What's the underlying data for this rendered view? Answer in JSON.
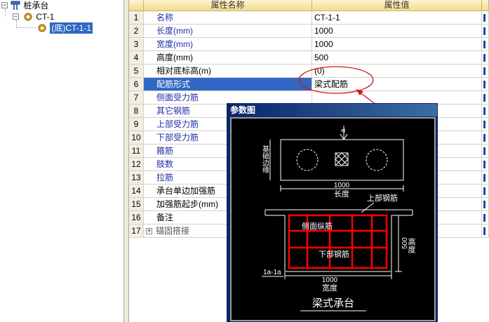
{
  "tree": {
    "root_label": "桩承台",
    "child_label": "CT-1",
    "leaf_label": "(底)CT-1-1"
  },
  "grid": {
    "header_name": "属性名称",
    "header_value": "属性值",
    "rows": [
      {
        "num": "1",
        "name": "名称",
        "value": "CT-1-1",
        "style": "blue"
      },
      {
        "num": "2",
        "name": "长度(mm)",
        "value": "1000",
        "style": "blue"
      },
      {
        "num": "3",
        "name": "宽度(mm)",
        "value": "1000",
        "style": "blue"
      },
      {
        "num": "4",
        "name": "高度(mm)",
        "value": "500",
        "style": "dark"
      },
      {
        "num": "5",
        "name": "相对底标高(m)",
        "value": "(0)",
        "style": "dark"
      },
      {
        "num": "6",
        "name": "配筋形式",
        "value": "梁式配筋",
        "style": "selected"
      },
      {
        "num": "7",
        "name": "侧面受力筋",
        "value": "",
        "style": "blue"
      },
      {
        "num": "8",
        "name": "其它钢筋",
        "value": "",
        "style": "blue"
      },
      {
        "num": "9",
        "name": "上部受力筋",
        "value": "",
        "style": "blue"
      },
      {
        "num": "10",
        "name": "下部受力筋",
        "value": "",
        "style": "blue"
      },
      {
        "num": "11",
        "name": "箍筋",
        "value": "",
        "style": "blue"
      },
      {
        "num": "12",
        "name": "肢数",
        "value": "",
        "style": "blue"
      },
      {
        "num": "13",
        "name": "拉筋",
        "value": "",
        "style": "blue"
      },
      {
        "num": "14",
        "name": "承台单边加强筋",
        "value": "",
        "style": "dark"
      },
      {
        "num": "15",
        "name": "加强筋起步(mm)",
        "value": "",
        "style": "dark"
      },
      {
        "num": "16",
        "name": "备注",
        "value": "",
        "style": "dark"
      },
      {
        "num": "17",
        "name": "锚固搭接",
        "value": "",
        "style": "group"
      }
    ]
  },
  "popup": {
    "title": "参数图",
    "dim_top": "a",
    "label_pile_edge": "基础边缘",
    "dim_length": "1000",
    "label_length": "长度",
    "label_top_bar": "上部钢筋",
    "label_side_bar": "侧面纵筋",
    "label_bottom_bar": "下部钢筋",
    "dim_height": "500",
    "label_height": "高度",
    "section_label": "1a-1a",
    "dim_width": "1000",
    "label_width": "宽度",
    "caption": "梁式承台"
  },
  "colors": {
    "selection": "#3167c5",
    "header": "#f4dc8a",
    "name_text": "#1f2ea8",
    "annotation": "#d9141c",
    "rebar": "#ff0000",
    "popup_title": "#0a246a"
  }
}
